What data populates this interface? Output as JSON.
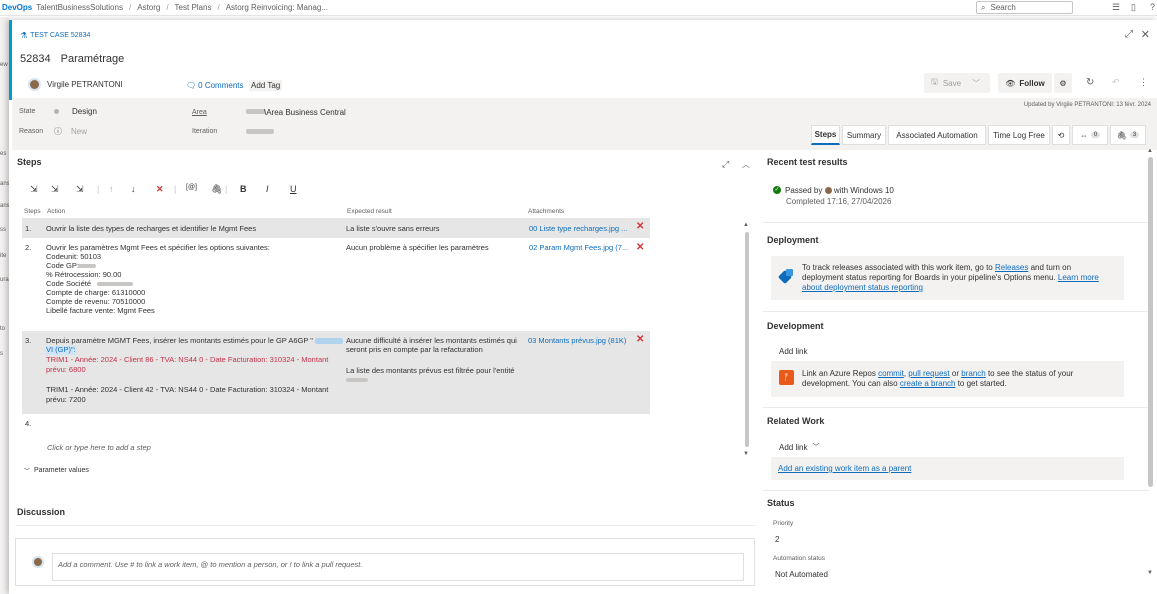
{
  "topbar": {
    "brand": "DevOps",
    "crumbs": [
      "TalentBusinessSolutions",
      "Astorg",
      "Test Plans",
      "Astorg Reinvoicing: Manag..."
    ],
    "search_placeholder": "Search"
  },
  "left_strip": [
    "ew",
    "es",
    "ans",
    "ans",
    "ss",
    "ite",
    "ura",
    "to",
    "s"
  ],
  "work_item": {
    "type_label": "TEST CASE 52834",
    "id": "52834",
    "title": "Paramétrage",
    "assignee": "Virgile PETRANTONI",
    "comments": "0 Comments",
    "add_tag": "Add Tag",
    "save": "Save",
    "follow": "Follow",
    "updated_by": "Updated by Virgile PETRANTONI: 13 févr. 2024"
  },
  "fields": {
    "state_label": "State",
    "state_value": "Design",
    "reason_label": "Reason",
    "reason_value": "New",
    "area_label": "Area",
    "area_value": "\\Area Business Central",
    "iteration_label": "Iteration"
  },
  "tabs": [
    "Steps",
    "Summary",
    "Associated Automation",
    "Time Log Free"
  ],
  "tab_counts": {
    "links": "0",
    "attachments": "3"
  },
  "steps_section": {
    "title": "Steps",
    "toolbar": [
      "B",
      "I",
      "U"
    ],
    "headers": {
      "steps": "Steps",
      "action": "Action",
      "expected": "Expected result",
      "attachments": "Attachments"
    },
    "rows": [
      {
        "num": "1.",
        "action": [
          "Ouvrir la liste des types de recharges et identifier le Mgmt Fees"
        ],
        "expected": [
          "La liste s'ouvre sans erreurs"
        ],
        "attachment": "00 Liste type recharges.jpg ..."
      },
      {
        "num": "2.",
        "action": [
          "Ouvrir les paramètres Mgmt Fees et spécifier les options suivantes:",
          "Codeunit: 50103",
          "Code GP:",
          "% Rétrocession: 90.00",
          "Code Société",
          "Compte de charge: 61310000",
          "Compte de revenu: 70510000",
          "Libellé facture vente: Mgmt Fees"
        ],
        "expected": [
          "Aucun problème à spécifier les paramètres"
        ],
        "attachment": "02 Param Mgmt Fees.jpg (7..."
      },
      {
        "num": "3.",
        "action_line1": "Depuis paramètre MGMT Fees, insérer les montants estimés pour le GP A6GP \"",
        "action_line2": "VI (GP)\":",
        "action_red": [
          "TRIM1 - Année: 2024 - Client 86 - TVA: NS44 0 - Date Facturation: 310324 - Montant",
          "prévu: 6800"
        ],
        "action_rest": [
          "TRIM1 - Année: 2024 - Client 42 - TVA: NS44 0 - Date Facturation: 310324 - Montant",
          "prévu: 7200"
        ],
        "expected": [
          "Aucune difficulté à insérer les montants estimés qui",
          "seront pris en compte par la refacturation",
          "",
          "La liste des montants prévus est filtrée pour l'entité"
        ],
        "attachment": "03 Montants prévus.jpg (81K)"
      }
    ],
    "empty_step_num": "4.",
    "add_step_placeholder": "Click or type here to add a step",
    "parameter_values": "Parameter values"
  },
  "discussion": {
    "title": "Discussion",
    "placeholder": "Add a comment. Use # to link a work item, @ to mention a person, or ! to link a pull request."
  },
  "right_panel": {
    "recent_results": {
      "title": "Recent test results",
      "passed_prefix": "Passed by",
      "passed_suffix": "with Windows 10",
      "completed": "Completed 17:16, 27/04/2026"
    },
    "deployment": {
      "title": "Deployment",
      "text1": "To track releases associated with this work item, go to",
      "link_releases": "Releases",
      "text2": "and turn on",
      "text3": "deployment status reporting for Boards in your pipeline's Options menu.",
      "link_learn": "Learn more",
      "link_about": "about deployment status reporting"
    },
    "development": {
      "title": "Development",
      "add_link": "Add link",
      "text1": "Link an Azure Repos",
      "link_commit": "commit",
      "link_pr": "pull request",
      "text_or": "or",
      "link_branch": "branch",
      "text2": "to see the status of your",
      "text3": "development. You can also",
      "link_create_branch": "create a branch",
      "text4": "to get started."
    },
    "related": {
      "title": "Related Work",
      "add_link": "Add link",
      "add_parent": "Add an existing work item as a parent"
    },
    "status": {
      "title": "Status",
      "priority_label": "Priority",
      "priority_value": "2",
      "automation_label": "Automation status",
      "automation_value": "Not Automated"
    }
  }
}
